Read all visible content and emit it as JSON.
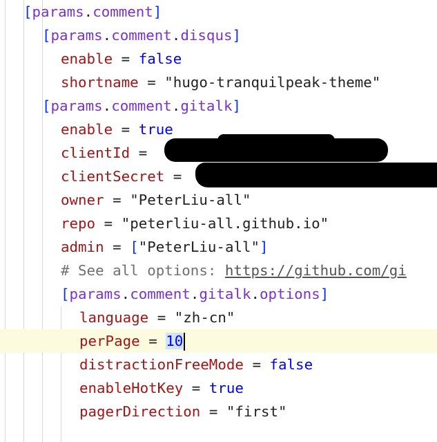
{
  "editor": {
    "lines": [
      {
        "indent": 1,
        "kind": "section",
        "bracket_open": "[",
        "path": [
          "params",
          "comment"
        ],
        "bracket_close": "]"
      },
      {
        "indent": 2,
        "kind": "section",
        "bracket_open": "[",
        "path": [
          "params",
          "comment",
          "disqus"
        ],
        "bracket_close": "]"
      },
      {
        "indent": 3,
        "kind": "kv",
        "key": "enable",
        "eq": "=",
        "value": "false",
        "value_type": "bool"
      },
      {
        "indent": 3,
        "kind": "kv",
        "key": "shortname",
        "eq": "=",
        "value": "\"hugo-tranquilpeak-theme\"",
        "value_type": "string"
      },
      {
        "indent": 2,
        "kind": "section",
        "bracket_open": "[",
        "path": [
          "params",
          "comment",
          "gitalk"
        ],
        "bracket_close": "]"
      },
      {
        "indent": 3,
        "kind": "kv",
        "key": "enable",
        "eq": "=",
        "value": "true",
        "value_type": "bool"
      },
      {
        "indent": 3,
        "kind": "kv",
        "key": "clientId",
        "eq": "=",
        "value": "",
        "value_type": "redacted"
      },
      {
        "indent": 3,
        "kind": "kv",
        "key": "clientSecret",
        "eq": "=",
        "value": "",
        "value_type": "redacted"
      },
      {
        "indent": 3,
        "kind": "kv",
        "key": "owner",
        "eq": "=",
        "value": "\"PeterLiu-all\"",
        "value_type": "string"
      },
      {
        "indent": 3,
        "kind": "kv",
        "key": "repo",
        "eq": "=",
        "value": "\"peterliu-all.github.io\"",
        "value_type": "string"
      },
      {
        "indent": 3,
        "kind": "kv",
        "key": "admin",
        "eq": "=",
        "value": "\"PeterLiu-all\"",
        "value_type": "array"
      },
      {
        "indent": 3,
        "kind": "comment",
        "text": "# See all options: ",
        "url": "https://github.com/gi"
      },
      {
        "indent": 3,
        "kind": "section",
        "bracket_open": "[",
        "path": [
          "params",
          "comment",
          "gitalk",
          "options"
        ],
        "bracket_close": "]"
      },
      {
        "indent": 4,
        "kind": "kv",
        "key": "language",
        "eq": "=",
        "value": "\"zh-cn\"",
        "value_type": "string"
      },
      {
        "indent": 4,
        "kind": "kv",
        "key": "perPage",
        "eq": "=",
        "value": "10",
        "value_type": "number",
        "current": true
      },
      {
        "indent": 4,
        "kind": "kv",
        "key": "distractionFreeMode",
        "eq": "=",
        "value": "false",
        "value_type": "bool"
      },
      {
        "indent": 4,
        "kind": "kv",
        "key": "enableHotKey",
        "eq": "=",
        "value": "true",
        "value_type": "bool"
      },
      {
        "indent": 4,
        "kind": "kv",
        "key": "pagerDirection",
        "eq": "=",
        "value": "\"first\"",
        "value_type": "string"
      }
    ]
  },
  "colors": {
    "key": "#a31515",
    "bool": "#0000ff",
    "bracket": "#0431fa",
    "section": "#7b30d0",
    "comment": "#707070",
    "current_line": "#fcfadf",
    "selection": "#cfe3fb"
  }
}
